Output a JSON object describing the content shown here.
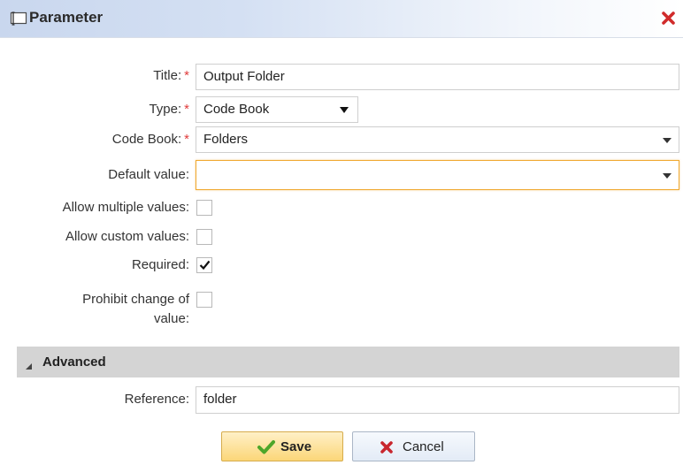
{
  "dialog": {
    "title": "Parameter"
  },
  "form": {
    "title_label": "Title:",
    "title_value": "Output Folder",
    "type_label": "Type:",
    "type_value": "Code Book",
    "codebook_label": "Code Book:",
    "codebook_value": "Folders",
    "default_label": "Default value:",
    "default_value": "",
    "required_marker": "*",
    "allow_multiple_label": "Allow multiple values:",
    "allow_multiple_checked": false,
    "allow_custom_label": "Allow custom values:",
    "allow_custom_checked": false,
    "required_label": "Required:",
    "required_checked": true,
    "prohibit_label_line1": "Prohibit change of",
    "prohibit_label_line2": "value:",
    "prohibit_checked": false
  },
  "advanced": {
    "header": "Advanced",
    "reference_label": "Reference:",
    "reference_value": "folder"
  },
  "buttons": {
    "save_label": "Save",
    "cancel_label": "Cancel"
  },
  "colors": {
    "required_marker": "#e03b3b",
    "close_icon": "#d02b2b",
    "save_check": "#4da62a",
    "focus_border": "#f0a830",
    "section_header": "#d4d4d4"
  },
  "icons": {
    "title": "parameter-icon",
    "close": "close-icon",
    "section_toggle": "triangle-icon",
    "save": "check-icon",
    "cancel": "x-icon"
  }
}
